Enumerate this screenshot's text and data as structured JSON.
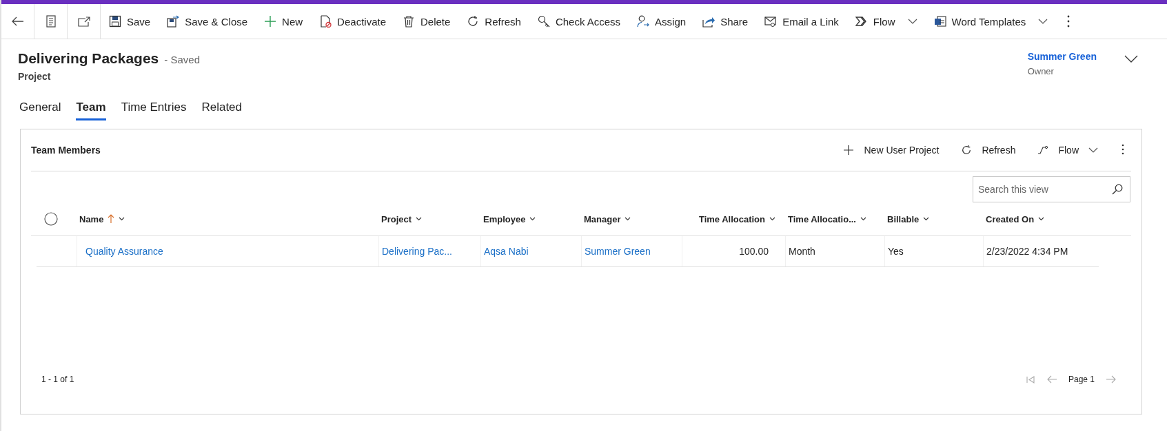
{
  "command_bar": {
    "items": [
      {
        "label": "Save",
        "has_menu": false
      },
      {
        "label": "Save & Close",
        "has_menu": false
      },
      {
        "label": "New",
        "has_menu": false
      },
      {
        "label": "Deactivate",
        "has_menu": false
      },
      {
        "label": "Delete",
        "has_menu": false
      },
      {
        "label": "Refresh",
        "has_menu": false
      },
      {
        "label": "Check Access",
        "has_menu": false
      },
      {
        "label": "Assign",
        "has_menu": false
      },
      {
        "label": "Share",
        "has_menu": false
      },
      {
        "label": "Email a Link",
        "has_menu": false
      },
      {
        "label": "Flow",
        "has_menu": true
      },
      {
        "label": "Word Templates",
        "has_menu": true
      }
    ]
  },
  "header": {
    "title": "Delivering Packages",
    "status": "- Saved",
    "entity": "Project",
    "owner": {
      "name": "Summer Green",
      "label": "Owner"
    }
  },
  "tabs": [
    {
      "label": "General",
      "selected": false
    },
    {
      "label": "Team",
      "selected": true
    },
    {
      "label": "Time Entries",
      "selected": false
    },
    {
      "label": "Related",
      "selected": false
    }
  ],
  "subgrid": {
    "title": "Team Members",
    "commands": [
      {
        "label": "New User Project",
        "has_menu": false
      },
      {
        "label": "Refresh",
        "has_menu": false
      },
      {
        "label": "Flow",
        "has_menu": true
      }
    ],
    "search": {
      "placeholder": "Search this view"
    },
    "all_selected": false,
    "columns": [
      {
        "label": "Name",
        "sorted_ascending": true
      },
      {
        "label": "Project",
        "sorted_ascending": false
      },
      {
        "label": "Employee",
        "sorted_ascending": false
      },
      {
        "label": "Manager",
        "sorted_ascending": false
      },
      {
        "label": "Time Allocation",
        "sorted_ascending": false
      },
      {
        "label": "Time Allocatio...",
        "sorted_ascending": false
      },
      {
        "label": "Billable",
        "sorted_ascending": false
      },
      {
        "label": "Created On",
        "sorted_ascending": false
      }
    ],
    "rows": [
      {
        "selected": false,
        "cells": [
          {
            "text": "Quality Assurance",
            "kind": "link"
          },
          {
            "text": "Delivering Pac...",
            "kind": "link"
          },
          {
            "text": "Aqsa Nabi",
            "kind": "link"
          },
          {
            "text": "Summer Green",
            "kind": "link"
          },
          {
            "text": "100.00",
            "kind": "number"
          },
          {
            "text": "Month",
            "kind": "text"
          },
          {
            "text": "Yes",
            "kind": "text"
          },
          {
            "text": "2/23/2022 4:34 PM",
            "kind": "text"
          }
        ]
      }
    ],
    "record_count": "1 - 1 of 1",
    "page": "Page 1"
  }
}
